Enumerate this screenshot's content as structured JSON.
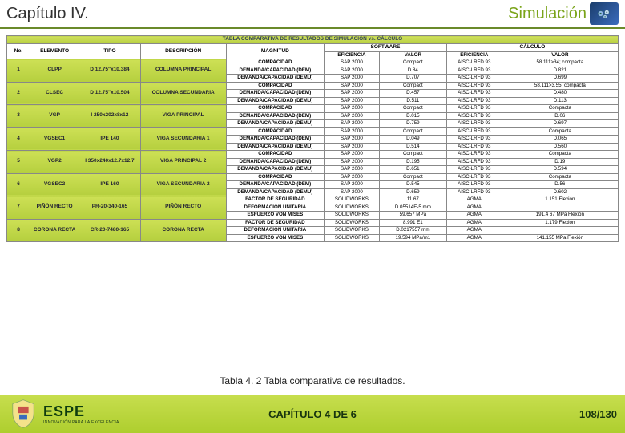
{
  "header": {
    "left": "Capítulo IV.",
    "right": "Simulación"
  },
  "tbl": {
    "banner": "TABLA COMPARATIVA DE RESULTADOS DE SIMULACIÓN vs. CÁLCULO",
    "h_no": "No.",
    "h_el": "ELEMENTO",
    "h_tipo": "TIPO",
    "h_desc": "DESCRIPCIÓN",
    "h_mag": "MAGNITUD",
    "h_soft": "SOFTWARE",
    "h_calc": "CÁLCULO",
    "h_eff": "EFICIENCIA",
    "h_val": "VALOR",
    "m_comp": "COMPACIDAD",
    "m_dmax": "DEMANDA/CAPACIDAD (DEM)",
    "m_dmaxu": "DEMANDA/CAPACIDAD (DEMU)",
    "m_fs": "FACTOR DE SEGURIDAD",
    "m_def": "DEFORMACIÓN UNITARIA",
    "m_vm": "ESFUERZO VON MISES",
    "r": [
      {
        "no": "1",
        "el": "CLPP",
        "tipo": "D 12.75\"x10.384",
        "desc": "COLUMNA PRINCIPAL",
        "rows": [
          {
            "mag": "m_comp",
            "seff": "SAP 2000",
            "sval": "Compact",
            "ceff": "AISC-LRFD 93",
            "cval": "58.111>34; compacta"
          },
          {
            "mag": "m_dmax",
            "seff": "SAP 2000",
            "sval": "D.84",
            "ceff": "AISC-LRFD 93",
            "cval": "D.821"
          },
          {
            "mag": "m_dmaxu",
            "seff": "SAP 2000",
            "sval": "D.707",
            "ceff": "AISC-LRFD 93",
            "cval": "D.699"
          }
        ]
      },
      {
        "no": "2",
        "el": "CLSEC",
        "tipo": "D 12.75\"x10.504",
        "desc": "COLUMNA SECUNDARIA",
        "rows": [
          {
            "mag": "m_comp",
            "seff": "SAP 2000",
            "sval": "Compact",
            "ceff": "AISC-LRFD 93",
            "cval": "58.111>3.55; compacta"
          },
          {
            "mag": "m_dmax",
            "seff": "SAP 2000",
            "sval": "D.457",
            "ceff": "AISC-LRFD 93",
            "cval": "D.480"
          },
          {
            "mag": "m_dmaxu",
            "seff": "SAP 2000",
            "sval": "D.511",
            "ceff": "AISC-LRFD 93",
            "cval": "D.113"
          }
        ]
      },
      {
        "no": "3",
        "el": "VGP",
        "tipo": "I 250x202x8x12",
        "desc": "VIGA PRINCIPAL",
        "rows": [
          {
            "mag": "m_comp",
            "seff": "SAP 2000",
            "sval": "Compact",
            "ceff": "AISC-LRFD 93",
            "cval": "Compacta"
          },
          {
            "mag": "m_dmax",
            "seff": "SAP 2000",
            "sval": "D.015",
            "ceff": "AISC-LRFD 93",
            "cval": "D.06"
          },
          {
            "mag": "m_dmaxu",
            "seff": "SAP 2000",
            "sval": "D.759",
            "ceff": "AISC-LRFD 93",
            "cval": "D.697"
          }
        ]
      },
      {
        "no": "4",
        "el": "VGSEC1",
        "tipo": "IPE 140",
        "desc": "VIGA SECUNDARIA 1",
        "rows": [
          {
            "mag": "m_comp",
            "seff": "SAP 2000",
            "sval": "Compact",
            "ceff": "AISC-LRFD 93",
            "cval": "Compacta"
          },
          {
            "mag": "m_dmax",
            "seff": "SAP 2000",
            "sval": "D.049",
            "ceff": "AISC-LRFD 93",
            "cval": "D.065"
          },
          {
            "mag": "m_dmaxu",
            "seff": "SAP 2000",
            "sval": "D.514",
            "ceff": "AISC-LRFD 93",
            "cval": "D.560"
          }
        ]
      },
      {
        "no": "5",
        "el": "VGP2",
        "tipo": "I 350x240x12.7x12.7",
        "desc": "VIGA PRINCIPAL 2",
        "rows": [
          {
            "mag": "m_comp",
            "seff": "SAP 2000",
            "sval": "Compact",
            "ceff": "AISC-LRFD 93",
            "cval": "Compacta"
          },
          {
            "mag": "m_dmax",
            "seff": "SAP 2000",
            "sval": "D.195",
            "ceff": "AISC-LRFD 93",
            "cval": "D.19"
          },
          {
            "mag": "m_dmaxu",
            "seff": "SAP 2000",
            "sval": "D.651",
            "ceff": "AISC-LRFD 93",
            "cval": "D.594"
          }
        ]
      },
      {
        "no": "6",
        "el": "VGSEC2",
        "tipo": "IPE 160",
        "desc": "VIGA SECUNDARIA 2",
        "rows": [
          {
            "mag": "m_comp",
            "seff": "SAP 2000",
            "sval": "Compact",
            "ceff": "AISC-LRFD 93",
            "cval": "Compacta"
          },
          {
            "mag": "m_dmax",
            "seff": "SAP 2000",
            "sval": "D.545",
            "ceff": "AISC-LRFD 93",
            "cval": "D.56"
          },
          {
            "mag": "m_dmaxu",
            "seff": "SAP 2000",
            "sval": "D.659",
            "ceff": "AISC-LRFD 93",
            "cval": "D.602"
          }
        ]
      },
      {
        "no": "7",
        "el": "PIÑÓN RECTO",
        "tipo": "PR-20-340-165",
        "desc": "PIÑÓN RECTO",
        "rows": [
          {
            "mag": "m_fs",
            "seff": "SOLIDWORKS",
            "sval": "11.67",
            "ceff": "AGMA",
            "cval": "1.151 Flexión"
          },
          {
            "mag": "m_def",
            "seff": "SOLIDWORKS",
            "sval": "D.05514E-5 mm",
            "ceff": "AGMA",
            "cval": ""
          },
          {
            "mag": "m_vm",
            "seff": "SOLIDWORKS",
            "sval": "59.657 MPa",
            "ceff": "AGMA",
            "cval": "191.4 67 MPa Flexión"
          }
        ]
      },
      {
        "no": "8",
        "el": "CORONA RECTA",
        "tipo": "CR-20-7480-165",
        "desc": "CORONA RECTA",
        "rows": [
          {
            "mag": "m_fs",
            "seff": "SOLIDWORKS",
            "sval": "8.991 E1",
            "ceff": "AGMA",
            "cval": "1.179 Flexión"
          },
          {
            "mag": "m_def",
            "seff": "SOLIDWORKS",
            "sval": "D.0217557 mm",
            "ceff": "AGMA",
            "cval": ""
          },
          {
            "mag": "m_vm",
            "seff": "SOLIDWORKS",
            "sval": "19.594 MPa/m1",
            "ceff": "AGMA",
            "cval": "141.155 MPa Flexión"
          }
        ]
      }
    ]
  },
  "caption": "Tabla 4. 2 Tabla comparativa de resultados.",
  "footer": {
    "espe": "ESPE",
    "espe_sub": "INNOVACIÓN PARA LA EXCELENCIA",
    "chapter": "CAPÍTULO 4 DE 6",
    "page": "108/130"
  }
}
